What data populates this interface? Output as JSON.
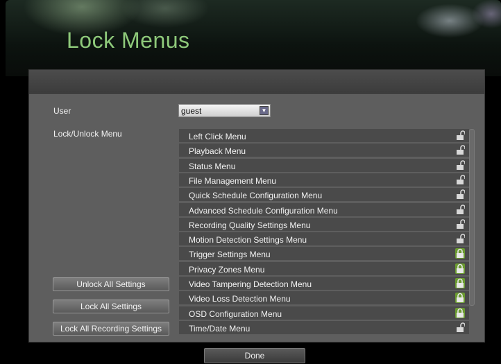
{
  "page": {
    "title": "Lock Menus"
  },
  "form": {
    "user_label": "User",
    "user_value": "guest",
    "lock_unlock_label": "Lock/Unlock Menu"
  },
  "menus": [
    {
      "label": "Left Click Menu",
      "locked": false
    },
    {
      "label": "Playback Menu",
      "locked": false
    },
    {
      "label": "Status Menu",
      "locked": false
    },
    {
      "label": "File Management Menu",
      "locked": false
    },
    {
      "label": "Quick Schedule Configuration Menu",
      "locked": false
    },
    {
      "label": "Advanced Schedule Configuration Menu",
      "locked": false
    },
    {
      "label": "Recording Quality Settings Menu",
      "locked": false
    },
    {
      "label": "Motion Detection Settings Menu",
      "locked": false
    },
    {
      "label": "Trigger Settings Menu",
      "locked": true
    },
    {
      "label": "Privacy Zones Menu",
      "locked": true
    },
    {
      "label": "Video Tampering Detection Menu",
      "locked": true
    },
    {
      "label": "Video Loss Detection Menu",
      "locked": true
    },
    {
      "label": "OSD Configuration Menu",
      "locked": true
    },
    {
      "label": "Time/Date Menu",
      "locked": false
    }
  ],
  "buttons": {
    "unlock_all": "Unlock All Settings",
    "lock_all": "Lock All Settings",
    "lock_all_recording": "Lock All Recording Settings",
    "done": "Done"
  },
  "colors": {
    "title": "#8ec97a",
    "locked_icon_bg": "#6a9a30",
    "unlocked_icon": "#d8d8d8"
  }
}
